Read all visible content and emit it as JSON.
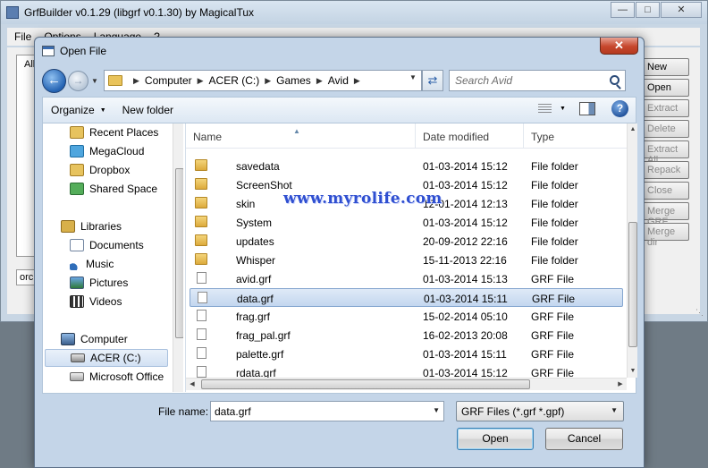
{
  "background_window": {
    "title": "GrfBuilder v0.1.29 (libgrf v0.1.30) by MagicalTux",
    "menu": [
      "File",
      "Options",
      "Language",
      "?"
    ],
    "list_fragment": "All",
    "input_fragment": "orc1",
    "buttons": [
      "New",
      "Open",
      "Extract",
      "Delete",
      "Extract All",
      "Repack",
      "Close",
      "Merge GRF",
      "Merge dir"
    ]
  },
  "dialog": {
    "title": "Open File",
    "address": {
      "crumbs": [
        "Computer",
        "ACER (C:)",
        "Games",
        "Avid"
      ]
    },
    "search": {
      "placeholder": "Search Avid"
    },
    "toolbar": {
      "organize": "Organize",
      "new_folder": "New folder"
    },
    "nav": {
      "favorites": [
        "Recent Places",
        "MegaCloud",
        "Dropbox",
        "Shared Space"
      ],
      "libraries_label": "Libraries",
      "libraries": [
        "Documents",
        "Music",
        "Pictures",
        "Videos"
      ],
      "computer_label": "Computer",
      "drives": [
        "ACER (C:)",
        "Microsoft Office"
      ],
      "selected": "ACER (C:)"
    },
    "columns": {
      "name": "Name",
      "date": "Date modified",
      "type": "Type"
    },
    "files": [
      {
        "name": "savedata",
        "date": "01-03-2014 15:12",
        "type": "File folder",
        "kind": "folder"
      },
      {
        "name": "ScreenShot",
        "date": "01-03-2014 15:12",
        "type": "File folder",
        "kind": "folder"
      },
      {
        "name": "skin",
        "date": "12-01-2014 12:13",
        "type": "File folder",
        "kind": "folder"
      },
      {
        "name": "System",
        "date": "01-03-2014 15:12",
        "type": "File folder",
        "kind": "folder"
      },
      {
        "name": "updates",
        "date": "20-09-2012 22:16",
        "type": "File folder",
        "kind": "folder"
      },
      {
        "name": "Whisper",
        "date": "15-11-2013 22:16",
        "type": "File folder",
        "kind": "folder"
      },
      {
        "name": "avid.grf",
        "date": "01-03-2014 15:13",
        "type": "GRF File",
        "kind": "file"
      },
      {
        "name": "data.grf",
        "date": "01-03-2014 15:11",
        "type": "GRF File",
        "kind": "file"
      },
      {
        "name": "frag.grf",
        "date": "15-02-2014 05:10",
        "type": "GRF File",
        "kind": "file"
      },
      {
        "name": "frag_pal.grf",
        "date": "16-02-2013 20:08",
        "type": "GRF File",
        "kind": "file"
      },
      {
        "name": "palette.grf",
        "date": "01-03-2014 15:11",
        "type": "GRF File",
        "kind": "file"
      },
      {
        "name": "rdata.grf",
        "date": "01-03-2014 15:12",
        "type": "GRF File",
        "kind": "file"
      }
    ],
    "selected_file": "data.grf",
    "filename_label": "File name:",
    "filename_value": "data.grf",
    "filter": "GRF Files (*.grf *.gpf)",
    "open_label": "Open",
    "cancel_label": "Cancel"
  },
  "watermark": "www.myrolife.com"
}
